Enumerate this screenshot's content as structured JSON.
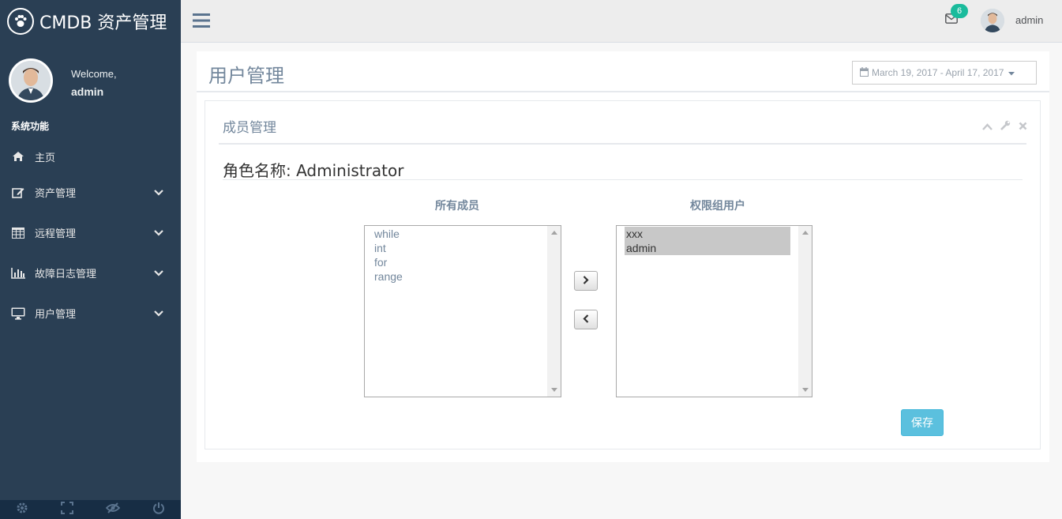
{
  "brand": {
    "title": "CMDB 资产管理",
    "icon": "paw-icon"
  },
  "profile": {
    "welcome": "Welcome,",
    "name": "admin"
  },
  "sidebar": {
    "section": "系统功能",
    "items": [
      {
        "label": "主页",
        "icon": "home-icon"
      },
      {
        "label": "资产管理",
        "icon": "edit-icon"
      },
      {
        "label": "远程管理",
        "icon": "table-icon"
      },
      {
        "label": "故障日志管理",
        "icon": "bar-chart-icon"
      },
      {
        "label": "用户管理",
        "icon": "desktop-icon"
      }
    ],
    "footer_icons": [
      "gear-icon",
      "fullscreen-icon",
      "eye-slash-icon",
      "power-icon"
    ]
  },
  "topnav": {
    "mail_count": "6",
    "username": "admin"
  },
  "page": {
    "title": "用户管理",
    "date_range": "March 19, 2017 - April 17, 2017"
  },
  "panel": {
    "title": "成员管理",
    "role_label": "角色名称: Administrator",
    "all_members_header": "所有成员",
    "group_users_header": "权限组用户",
    "all_members": [
      "while",
      "int",
      "for",
      "range"
    ],
    "group_users": [
      "xxx",
      "admin"
    ],
    "save_label": "保存"
  },
  "colors": {
    "sidebar": "#2A3F54",
    "accent": "#1ABB9C",
    "info": "#5BC0DE"
  }
}
